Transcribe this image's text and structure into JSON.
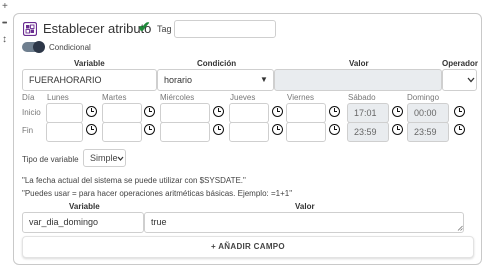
{
  "gutter_icons": [
    "+",
    "•••",
    "↕"
  ],
  "header": {
    "title": "Establecer atributo",
    "tag_label": "Tag",
    "tag_value": ""
  },
  "conditional": {
    "label": "Condicional",
    "enabled": true
  },
  "row_headers": {
    "variable": "Variable",
    "condition": "Condición",
    "value": "Valor",
    "operator": "Operador"
  },
  "condition_row": {
    "variable": "FUERAHORARIO",
    "condition": "horario",
    "value": "",
    "operator": ""
  },
  "days": {
    "dia_label": "Día",
    "inicio_label": "Inicio",
    "fin_label": "Fin",
    "names": [
      "Lunes",
      "Martes",
      "Miércoles",
      "Jueves",
      "Viernes",
      "Sábado",
      "Domingo"
    ],
    "inicio": [
      "",
      "",
      "",
      "",
      "",
      "17:01",
      "00:00"
    ],
    "fin": [
      "",
      "",
      "",
      "",
      "",
      "23:59",
      "23:59"
    ]
  },
  "tipo": {
    "label": "Tipo de variable",
    "value": "Simple"
  },
  "notes": [
    "\"La fecha actual del sistema se puede utilizar con $SYSDATE.\"",
    "\"Puedes usar = para hacer operaciones aritméticas básicas. Ejemplo: =1+1\""
  ],
  "assign": {
    "variable_header": "Variable",
    "value_header": "Valor",
    "variable": "var_dia_domingo",
    "value": "true"
  },
  "add_field": "+ AÑADIR CAMPO",
  "colors": {
    "check": "#1e8a3a",
    "toggle": "#2d3748"
  }
}
